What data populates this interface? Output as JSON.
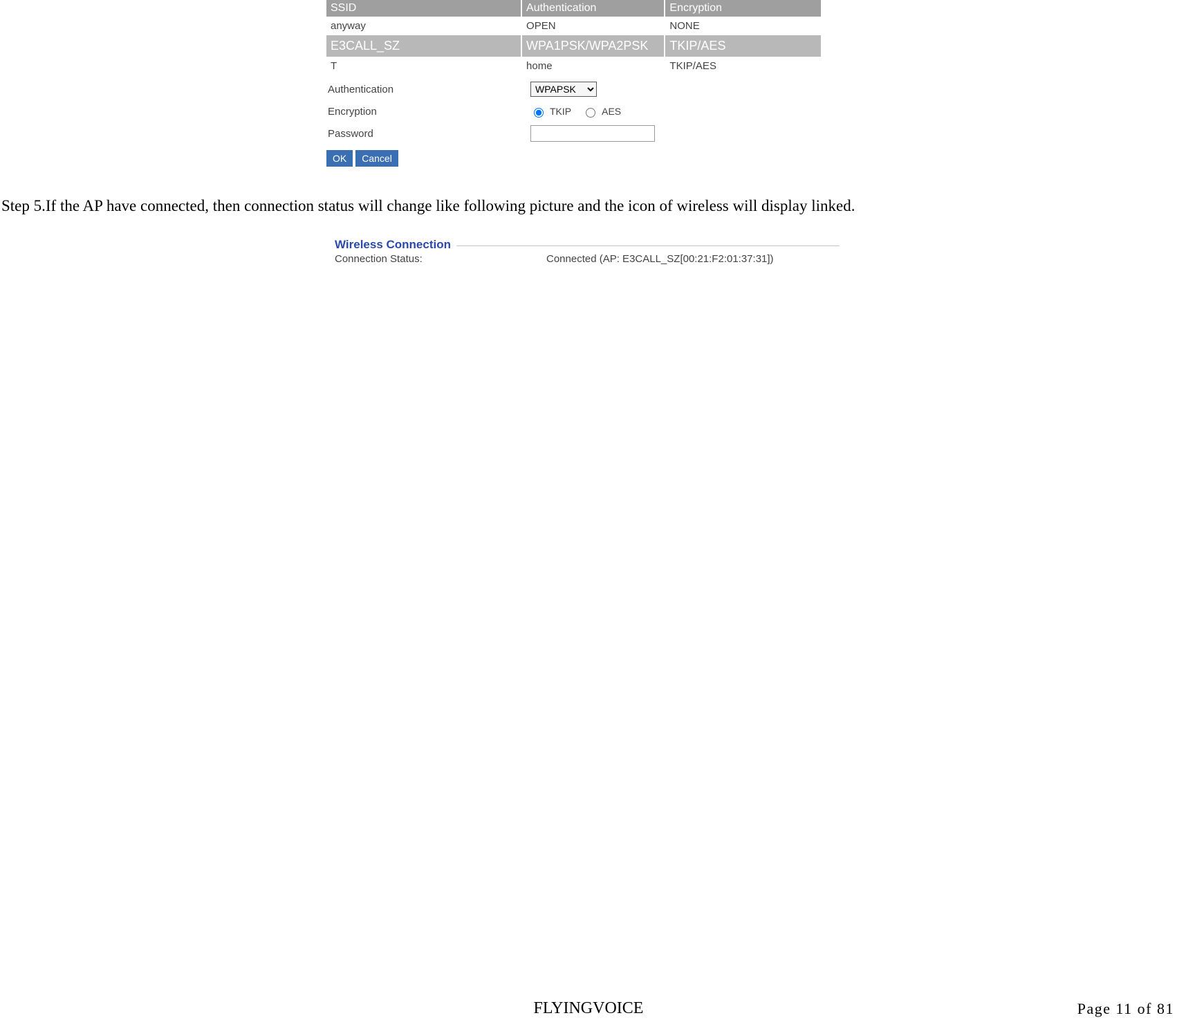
{
  "ap_table": {
    "headers": {
      "ssid": "SSID",
      "auth": "Authentication",
      "enc": "Encryption"
    },
    "rows": [
      {
        "ssid": "anyway",
        "auth": "OPEN",
        "enc": "NONE",
        "selected": false
      },
      {
        "ssid": "E3CALL_SZ",
        "auth": "WPA1PSK/WPA2PSK",
        "enc": "TKIP/AES",
        "selected": true
      },
      {
        "ssid": "T",
        "auth": "home",
        "enc": "TKIP/AES",
        "selected": false
      }
    ]
  },
  "form": {
    "authentication": {
      "label": "Authentication",
      "value": "WPAPSK"
    },
    "encryption": {
      "label": "Encryption",
      "options": {
        "tkip": "TKIP",
        "aes": "AES"
      },
      "selected": "tkip"
    },
    "password": {
      "label": "Password",
      "value": ""
    },
    "buttons": {
      "ok": "OK",
      "cancel": "Cancel"
    }
  },
  "paragraph": "Step 5.If the AP have connected, then connection status will change like following picture and the icon of wireless will display linked.",
  "status": {
    "legend": "Wireless Connection",
    "label": "Connection Status:",
    "value": "Connected (AP: E3CALL_SZ[00:21:F2:01:37:31])"
  },
  "footer": {
    "brand": "FLYINGVOICE",
    "page": "Page 11 of 81"
  }
}
